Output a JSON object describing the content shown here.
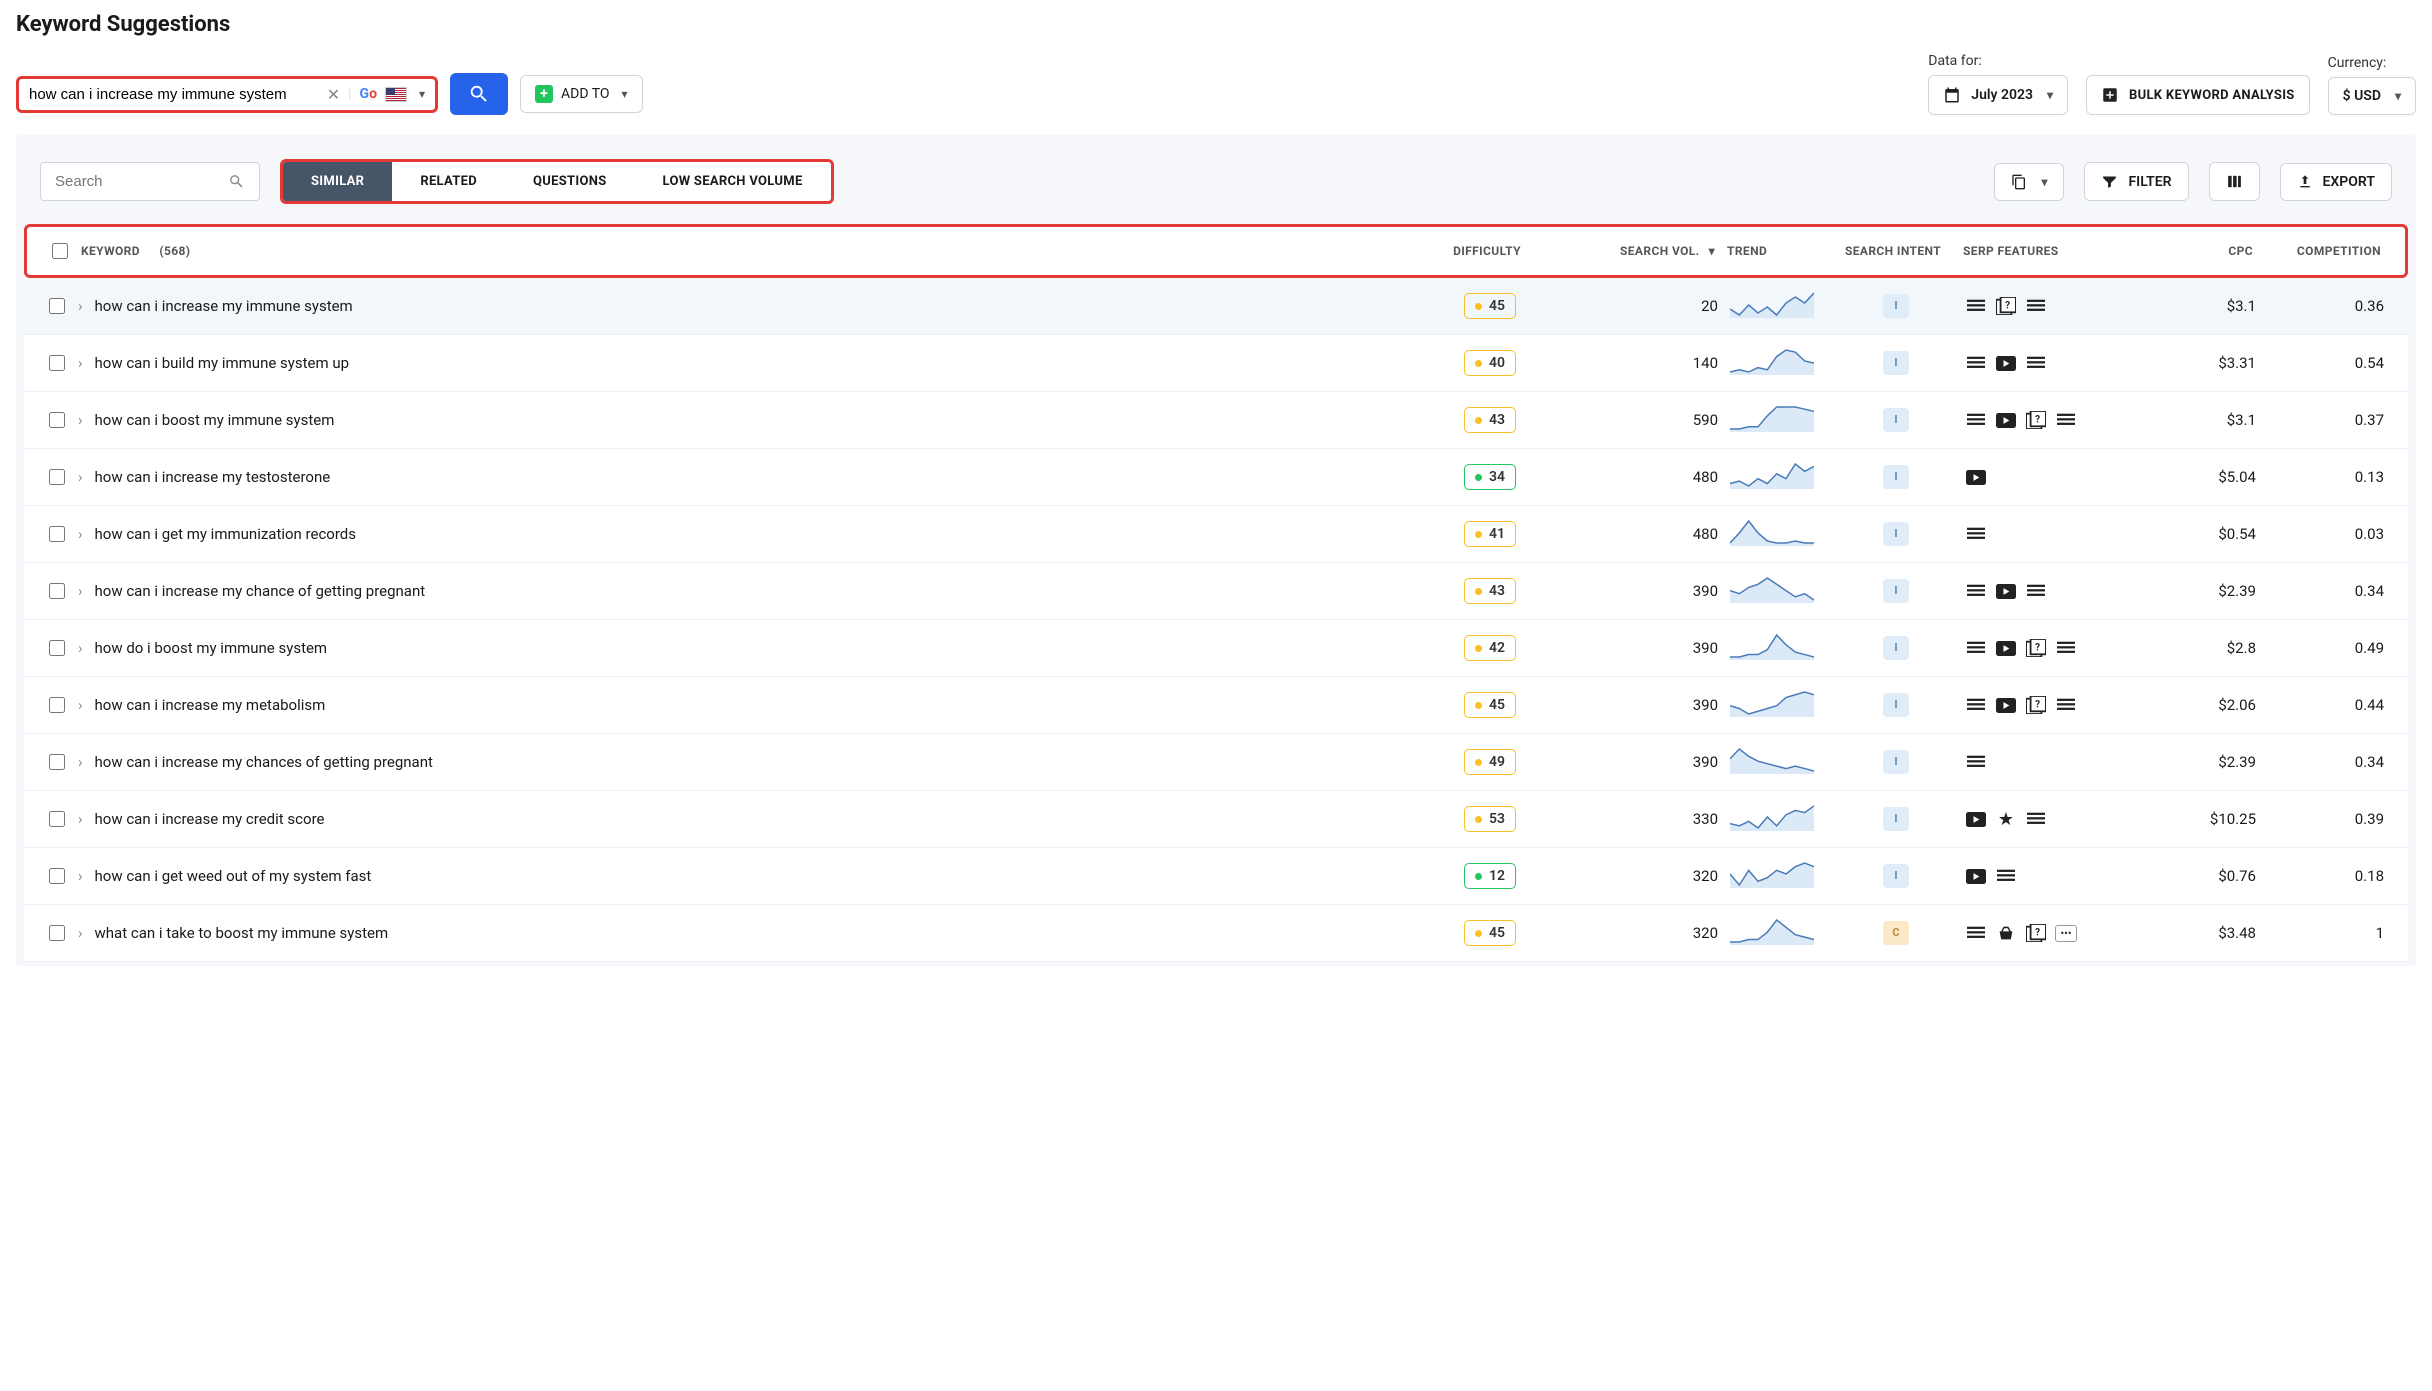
{
  "title": "Keyword Suggestions",
  "search": {
    "query": "how can i increase my immune system"
  },
  "addto": "ADD TO",
  "controls": {
    "datafor_label": "Data for:",
    "datafor_value": "July 2023",
    "bulk": "BULK KEYWORD ANALYSIS",
    "currency_label": "Currency:",
    "currency_value": "$ USD"
  },
  "filter_search_placeholder": "Search",
  "tabs": [
    "SIMILAR",
    "RELATED",
    "QUESTIONS",
    "LOW SEARCH VOLUME"
  ],
  "buttons": {
    "filter": "FILTER",
    "export": "EXPORT"
  },
  "headers": {
    "keyword": "KEYWORD",
    "count": "(568)",
    "difficulty": "DIFFICULTY",
    "vol": "SEARCH VOL.",
    "trend": "TREND",
    "intent": "SEARCH INTENT",
    "serp": "SERP FEATURES",
    "cpc": "CPC",
    "comp": "COMPETITION"
  },
  "rows": [
    {
      "kw": "how can i increase my immune system",
      "diff": 45,
      "diffc": "yellow",
      "vol": "20",
      "intent": "I",
      "serp": [
        "lines",
        "qbox",
        "lines2"
      ],
      "cpc": "$3.1",
      "comp": "0.36",
      "trend": [
        6,
        3,
        8,
        4,
        7,
        3,
        9,
        12,
        9,
        14
      ],
      "hl": true
    },
    {
      "kw": "how can i build my immune system up",
      "diff": 40,
      "diffc": "yellow",
      "vol": "140",
      "intent": "I",
      "serp": [
        "lines",
        "video",
        "lines2"
      ],
      "cpc": "$3.31",
      "comp": "0.54",
      "trend": [
        3,
        4,
        3,
        5,
        4,
        10,
        13,
        12,
        8,
        7
      ]
    },
    {
      "kw": "how can i boost my immune system",
      "diff": 43,
      "diffc": "yellow",
      "vol": "590",
      "intent": "I",
      "serp": [
        "lines",
        "video",
        "qbox2",
        "lines2"
      ],
      "cpc": "$3.1",
      "comp": "0.37",
      "trend": [
        3,
        3,
        4,
        4,
        9,
        13,
        13,
        13,
        12,
        11
      ]
    },
    {
      "kw": "how can i increase my testosterone",
      "diff": 34,
      "diffc": "green",
      "vol": "480",
      "intent": "I",
      "serp": [
        "video"
      ],
      "cpc": "$5.04",
      "comp": "0.13",
      "trend": [
        4,
        5,
        3,
        6,
        4,
        8,
        6,
        12,
        9,
        11
      ]
    },
    {
      "kw": "how can i get my immunization records",
      "diff": 41,
      "diffc": "yellow",
      "vol": "480",
      "intent": "I",
      "serp": [
        "lines"
      ],
      "cpc": "$0.54",
      "comp": "0.03",
      "trend": [
        3,
        8,
        14,
        8,
        4,
        3,
        3,
        4,
        3,
        3
      ]
    },
    {
      "kw": "how can i increase my chance of getting pregnant",
      "diff": 43,
      "diffc": "yellow",
      "vol": "390",
      "intent": "I",
      "serp": [
        "lines",
        "video",
        "lines2"
      ],
      "cpc": "$2.39",
      "comp": "0.34",
      "trend": [
        8,
        7,
        9,
        10,
        12,
        10,
        8,
        6,
        7,
        5
      ]
    },
    {
      "kw": "how do i boost my immune system",
      "diff": 42,
      "diffc": "yellow",
      "vol": "390",
      "intent": "I",
      "serp": [
        "lines",
        "video",
        "qbox2",
        "lines2"
      ],
      "cpc": "$2.8",
      "comp": "0.49",
      "trend": [
        3,
        3,
        4,
        4,
        6,
        12,
        8,
        5,
        4,
        3
      ]
    },
    {
      "kw": "how can i increase my metabolism",
      "diff": 45,
      "diffc": "yellow",
      "vol": "390",
      "intent": "I",
      "serp": [
        "lines",
        "video",
        "qbox2",
        "lines2"
      ],
      "cpc": "$2.06",
      "comp": "0.44",
      "trend": [
        7,
        6,
        4,
        5,
        6,
        7,
        10,
        11,
        12,
        11
      ]
    },
    {
      "kw": "how can i increase my chances of getting pregnant",
      "diff": 49,
      "diffc": "yellow",
      "vol": "390",
      "intent": "I",
      "serp": [
        "lines"
      ],
      "cpc": "$2.39",
      "comp": "0.34",
      "trend": [
        9,
        13,
        10,
        8,
        7,
        6,
        5,
        6,
        5,
        4
      ]
    },
    {
      "kw": "how can i increase my credit score",
      "diff": 53,
      "diffc": "yellow",
      "vol": "330",
      "intent": "I",
      "serp": [
        "video",
        "star",
        "lines2"
      ],
      "cpc": "$10.25",
      "comp": "0.39",
      "trend": [
        5,
        4,
        6,
        3,
        8,
        4,
        9,
        11,
        10,
        13
      ]
    },
    {
      "kw": "how can i get weed out of my system fast",
      "diff": 12,
      "diffc": "green",
      "vol": "320",
      "intent": "I",
      "serp": [
        "video",
        "lines"
      ],
      "cpc": "$0.76",
      "comp": "0.18",
      "trend": [
        7,
        4,
        8,
        5,
        6,
        8,
        7,
        9,
        10,
        9
      ]
    },
    {
      "kw": "what can i take to boost my immune system",
      "diff": 45,
      "diffc": "yellow",
      "vol": "320",
      "intent": "C",
      "serp": [
        "lines",
        "basket",
        "qbox2",
        "dots"
      ],
      "cpc": "$3.48",
      "comp": "1",
      "trend": [
        3,
        3,
        4,
        4,
        7,
        12,
        9,
        6,
        5,
        4
      ]
    }
  ]
}
